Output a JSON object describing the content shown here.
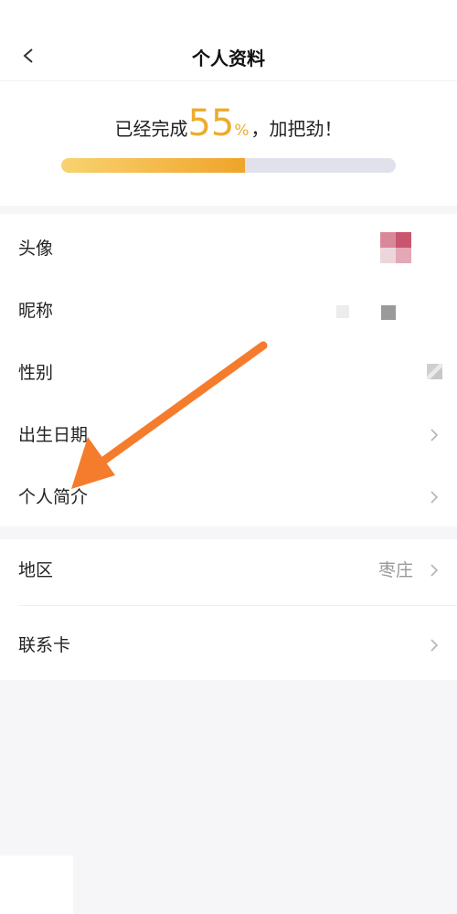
{
  "header": {
    "back_icon": "chevron-left-icon",
    "title": "个人资料"
  },
  "progress": {
    "prefix": "已经完成",
    "value": 55,
    "value_text": "55",
    "percent_sign": "%",
    "suffix": "，加把劲！"
  },
  "profile_rows": [
    {
      "label": "头像"
    },
    {
      "label": "昵称"
    },
    {
      "label": "性别"
    },
    {
      "label": "出生日期"
    },
    {
      "label": "个人简介"
    }
  ],
  "other_rows": [
    {
      "label": "地区",
      "value": "枣庄"
    },
    {
      "label": "联系卡"
    }
  ],
  "colors": {
    "accent": "#ecac2c",
    "arrow": "#f47c2c",
    "progress_track": "#e1e1ec"
  },
  "annotation": {
    "icon": "pointer-arrow-icon"
  }
}
